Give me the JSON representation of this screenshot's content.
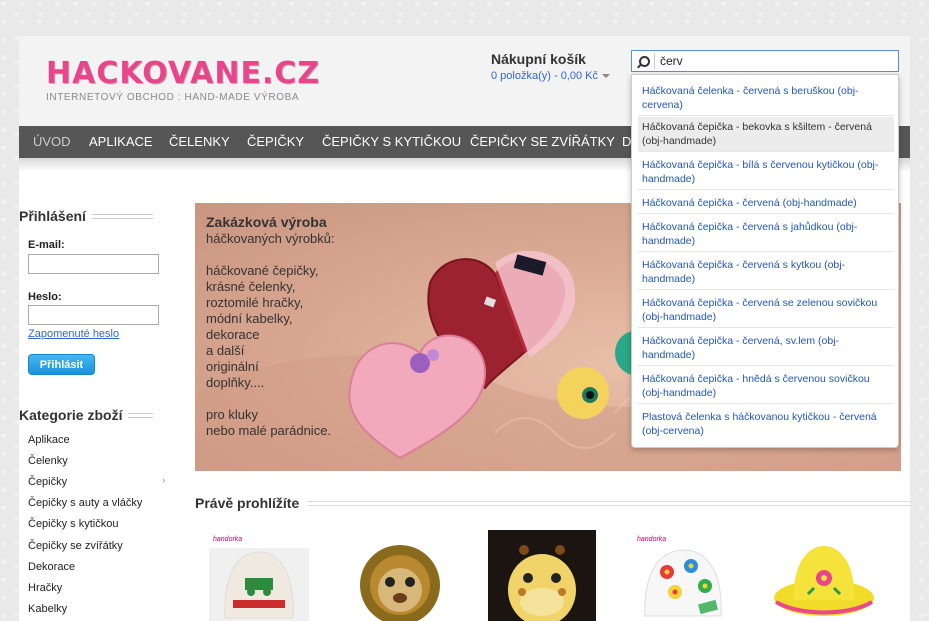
{
  "header": {
    "logo": "HACKOVANE.CZ",
    "tagline": "INTERNETOVÝ OBCHOD : HAND-MADE VÝROBA",
    "cart_title": "Nákupní košík",
    "cart_summary": "0 položka(y) - 0,00 Kč",
    "search_value": "červ"
  },
  "nav": {
    "items": [
      "ÚVOD",
      "APLIKACE",
      "ČELENKY",
      "ČEPIČKY",
      "ČEPIČKY S KYTIČKOU",
      "ČEPIČKY SE ZVÍŘÁTKY",
      "D"
    ]
  },
  "login": {
    "heading": "Přihlášení",
    "email_label": "E-mail:",
    "password_label": "Heslo:",
    "forgot": "Zapomenuté heslo",
    "submit": "Přihlásit"
  },
  "categories": {
    "heading": "Kategorie zboží",
    "items": [
      "Aplikace",
      "Čelenky",
      "Čepičky",
      "Čepičky s auty a vláčky",
      "Čepičky s kytičkou",
      "Čepičky se zvířátky",
      "Dekorace",
      "Hračky",
      "Kabelky"
    ]
  },
  "banner": {
    "title": "Zakázková výroba",
    "lines": [
      "háčkovaných výrobků:",
      "",
      "háčkované čepičky,",
      "krásné čelenky,",
      "roztomilé hračky,",
      "módní kabelky,",
      "dekorace",
      "a další",
      "originální",
      "doplňky....",
      "",
      "pro kluky",
      "nebo malé parádnice."
    ]
  },
  "recent": {
    "heading": "Právě prohlížíte",
    "thumb_label": "handorka"
  },
  "suggestions": [
    "Háčkovaná čelenka - červená s beruškou (obj-cervena)",
    "Háčkovaná čepička - bekovka s kšiltem - červená (obj-handmade)",
    "Háčkovaná čepička - bílá s červenou kytičkou (obj-handmade)",
    "Háčkovaná čepička - červená (obj-handmade)",
    "Háčkovaná čepička - červená s jahůdkou (obj-handmade)",
    "Háčkovaná čepička - červená s kytkou (obj-handmade)",
    "Háčkovaná čepička - červená se zelenou sovičkou (obj-handmade)",
    "Háčkovaná čepička - červená, sv.lem (obj-handmade)",
    "Háčkovaná čepička - hnědá s červenou sovičkou (obj-handmade)",
    "Plastová čelenka s háčkovanou kytičkou - červená (obj-cervena)"
  ],
  "colors": {
    "brand_pink": "#e8458b",
    "nav_bg": "#565656",
    "link_blue": "#3366cc"
  }
}
